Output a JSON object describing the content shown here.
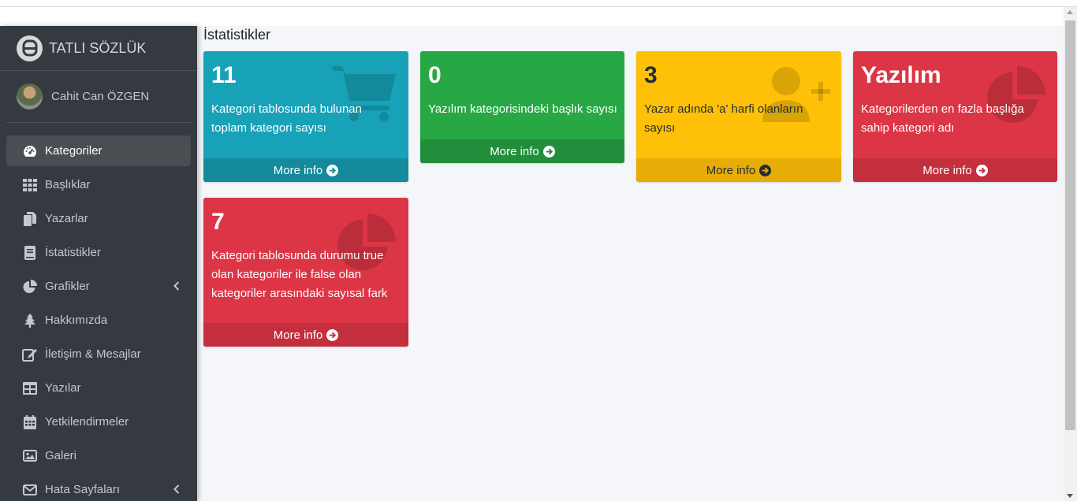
{
  "brand": {
    "title": "TATLI SÖZLÜK"
  },
  "user": {
    "name": "Cahit Can ÖZGEN"
  },
  "sidebar": {
    "items": [
      {
        "label": "Kategoriler",
        "icon": "tachometer-icon",
        "active": true
      },
      {
        "label": "Başlıklar",
        "icon": "grid-icon"
      },
      {
        "label": "Yazarlar",
        "icon": "copy-icon"
      },
      {
        "label": "İstatistikler",
        "icon": "book-icon"
      },
      {
        "label": "Grafikler",
        "icon": "pie-chart-icon",
        "has_submenu": true
      },
      {
        "label": "Hakkımızda",
        "icon": "tree-icon"
      },
      {
        "label": "İletişim & Mesajlar",
        "icon": "edit-icon"
      },
      {
        "label": "Yazılar",
        "icon": "table-icon"
      },
      {
        "label": "Yetkilendirmeler",
        "icon": "calendar-icon"
      },
      {
        "label": "Galeri",
        "icon": "image-icon"
      },
      {
        "label": "Hata Sayfaları",
        "icon": "envelope-icon",
        "has_submenu": true
      }
    ]
  },
  "main": {
    "title": "İstatistikler",
    "boxes": [
      {
        "value": "11",
        "description_line1": "Kategori tablosunda bulunan",
        "description_line2": "toplam kategori sayısı",
        "footer": "More info",
        "color": "#17a2b8",
        "icon": "shopping-cart-icon"
      },
      {
        "value": "0",
        "description_line1": "Yazılım kategorisindeki başlık sayısı",
        "footer": "More info",
        "color": "#28a745",
        "icon": "none"
      },
      {
        "value": "3",
        "description_line1": "Yazar adında 'a' harfi olanların",
        "description_line2": "sayısı",
        "footer": "More info",
        "color": "#ffc107",
        "icon": "user-plus-icon"
      },
      {
        "value": "Yazılım",
        "description_line1": "Kategorilerden en fazla başlığa",
        "description_line2": "sahip kategori adı",
        "footer": "More info",
        "color": "#dc3545",
        "icon": "pie-chart-icon"
      },
      {
        "value": "7",
        "description_line1": "Kategori tablosunda durumu true",
        "description_line2": "olan kategoriler ile false olan",
        "description_line3": "kategoriler arasındaki sayısal fark",
        "footer": "More info",
        "color": "#dc3545",
        "icon": "pie-chart-icon"
      }
    ]
  }
}
